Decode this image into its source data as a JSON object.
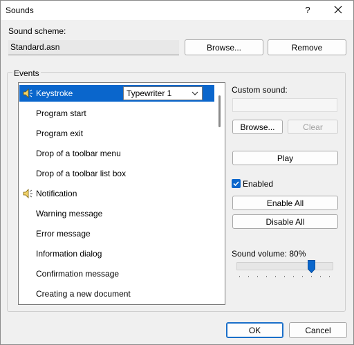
{
  "window": {
    "title": "Sounds",
    "help_label": "?"
  },
  "scheme": {
    "label": "Sound scheme:",
    "value": "Standard.asn",
    "browse_label": "Browse...",
    "remove_label": "Remove"
  },
  "events": {
    "group_label": "Events",
    "items": [
      {
        "label": "Keystroke",
        "icon": "speaker-icon",
        "selected": true,
        "sound": "Typewriter 1"
      },
      {
        "label": "Program start"
      },
      {
        "label": "Program exit"
      },
      {
        "label": "Drop of a toolbar menu"
      },
      {
        "label": "Drop of a toolbar list box"
      },
      {
        "label": "Notification",
        "icon": "speaker-icon"
      },
      {
        "label": "Warning message"
      },
      {
        "label": "Error message"
      },
      {
        "label": "Information dialog"
      },
      {
        "label": "Confirmation message"
      },
      {
        "label": "Creating a new document"
      }
    ]
  },
  "custom_sound": {
    "label": "Custom sound:",
    "value": "",
    "browse_label": "Browse...",
    "clear_label": "Clear"
  },
  "play_label": "Play",
  "enabled": {
    "label": "Enabled",
    "checked": true
  },
  "enable_all_label": "Enable All",
  "disable_all_label": "Disable All",
  "volume": {
    "label": "Sound volume: 80%",
    "value": 80
  },
  "footer": {
    "ok_label": "OK",
    "cancel_label": "Cancel"
  },
  "colors": {
    "selection": "#0a66cc",
    "window_bg": "#f0f0f0"
  }
}
